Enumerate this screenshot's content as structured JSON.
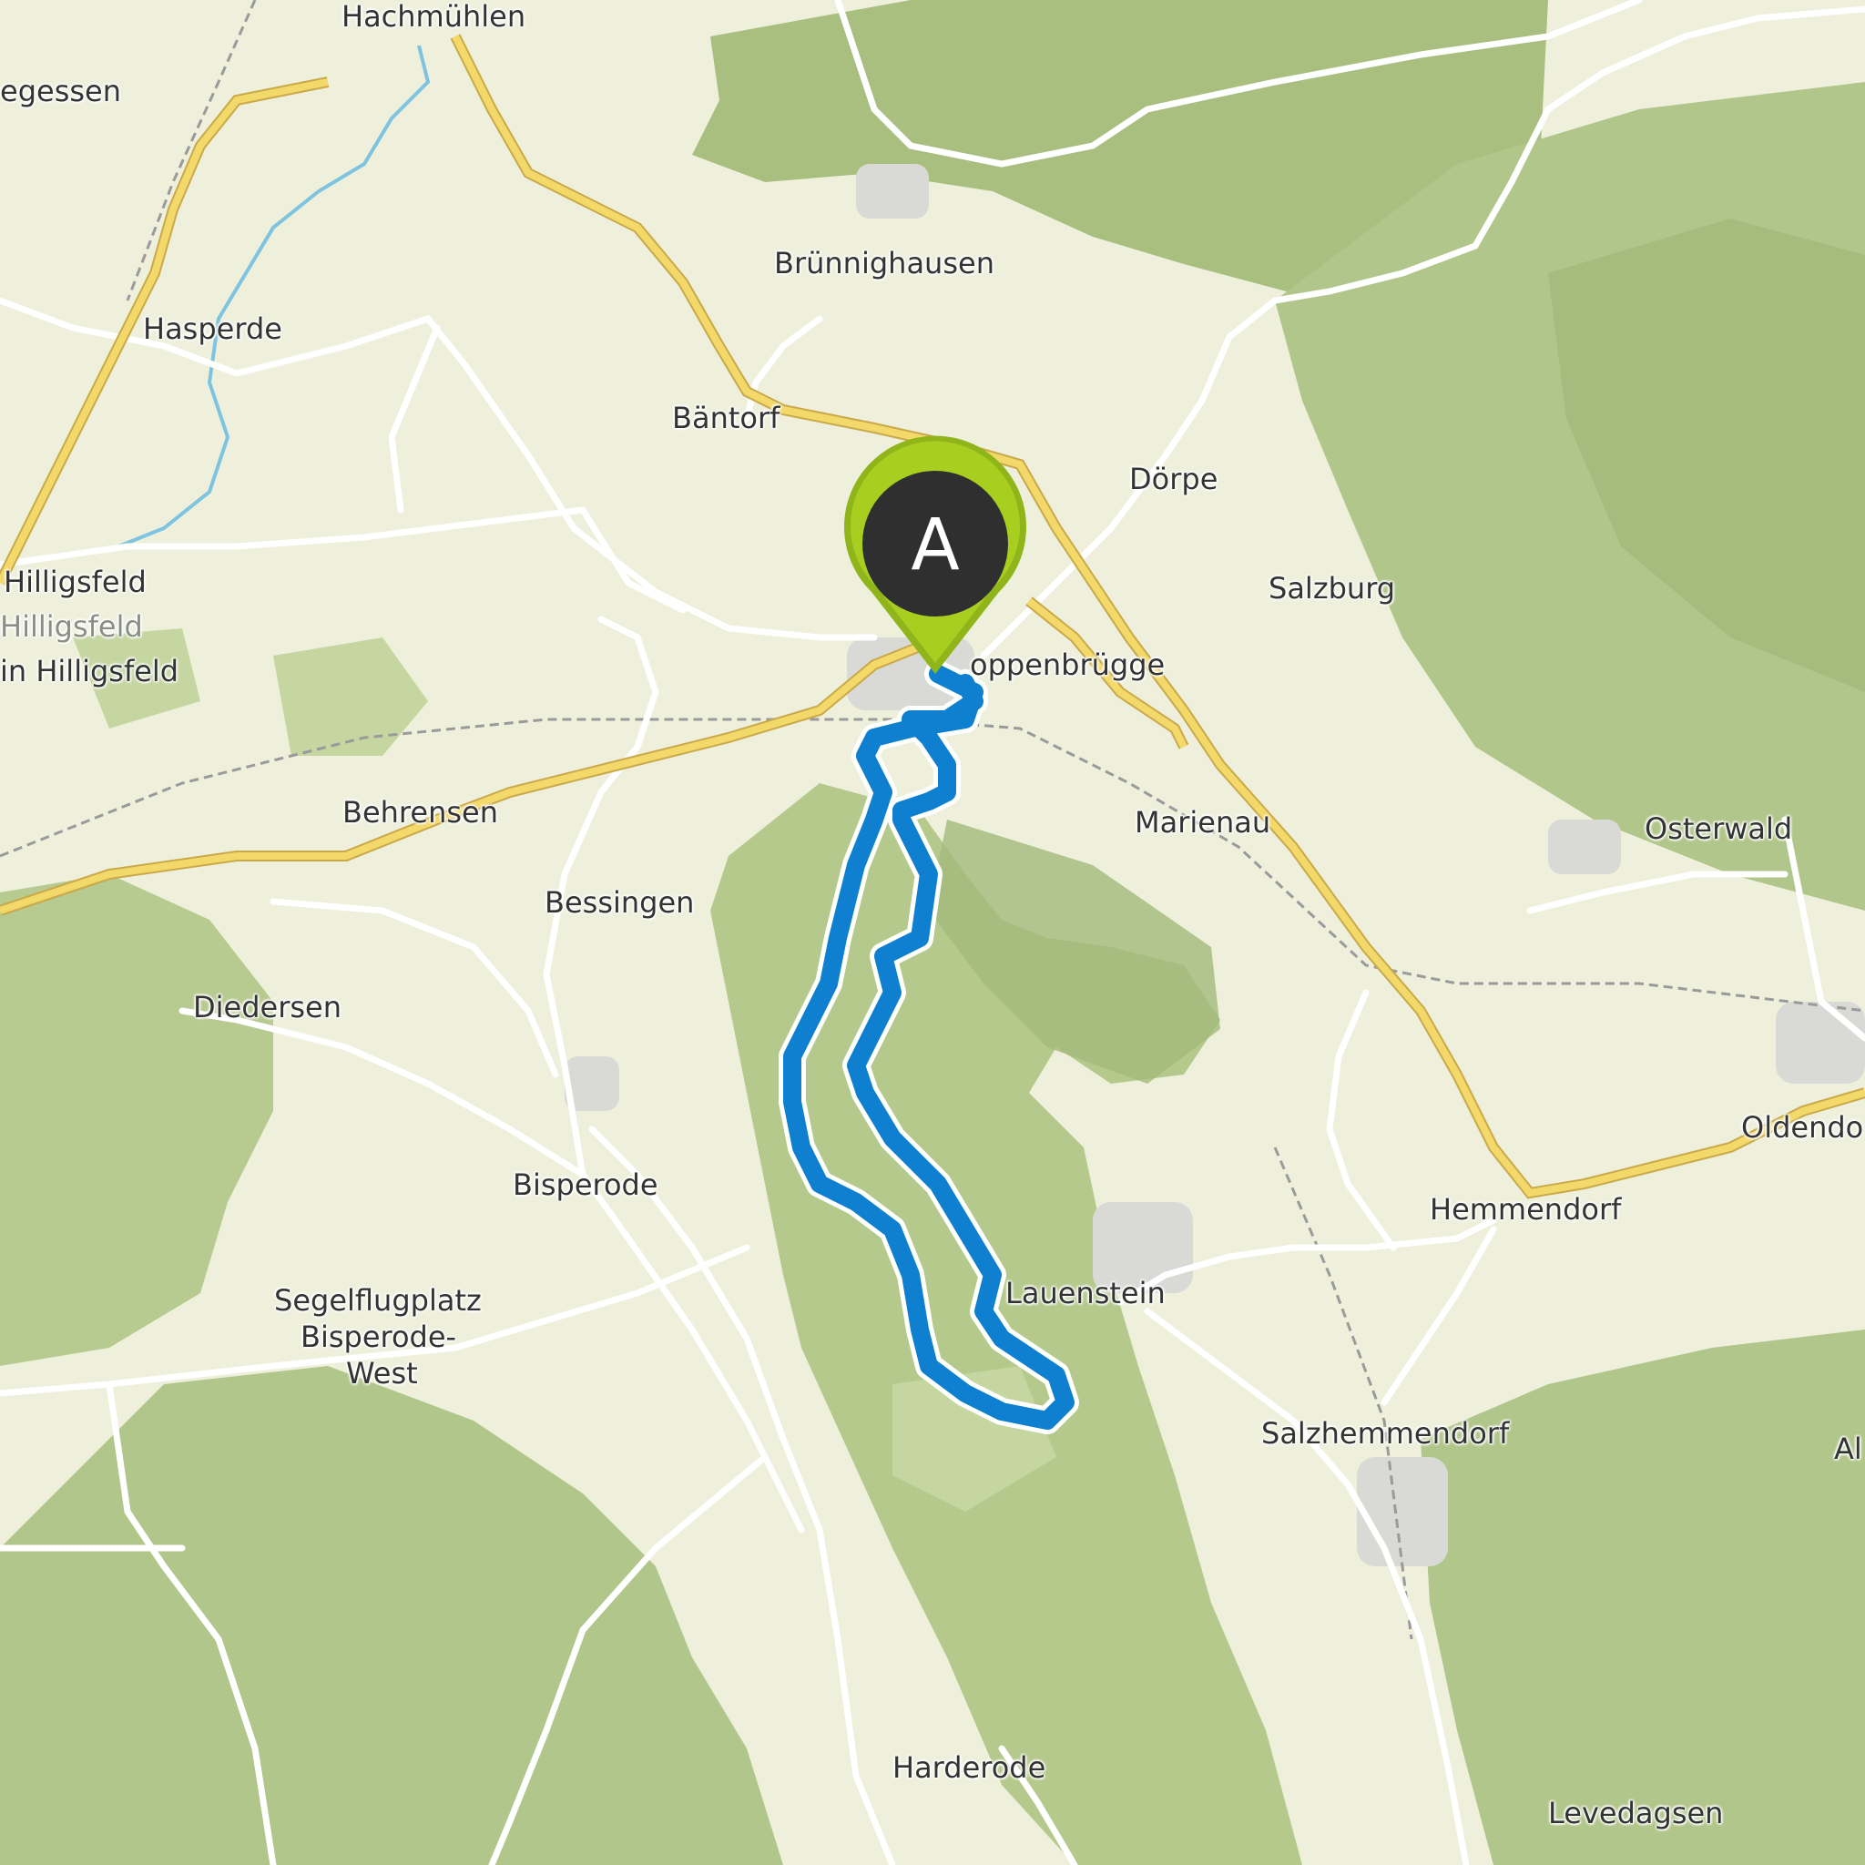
{
  "map": {
    "colors": {
      "base": "#eef0dc",
      "forest": "#b5c98c",
      "forest_dark": "#9fb676",
      "major_road": "#f3d86a",
      "minor_road": "#ffffff",
      "water": "#7ec3df",
      "route": "#0f7fd0",
      "route_casing": "#ffffff",
      "marker_fill": "#a8cf1f",
      "marker_inner": "#2f2f2f"
    },
    "marker": {
      "label": "A",
      "icon": "map-pin-icon"
    },
    "places": [
      {
        "id": "hachmuehlen",
        "name": "Hachmühlen"
      },
      {
        "id": "egessen",
        "name": "egessen"
      },
      {
        "id": "bruennighausen",
        "name": "Brünnighausen"
      },
      {
        "id": "hasperde",
        "name": "Hasperde"
      },
      {
        "id": "baentorf",
        "name": "Bäntorf"
      },
      {
        "id": "doerpe",
        "name": "Dörpe"
      },
      {
        "id": "hilligsfeld",
        "name": "Hilligsfeld"
      },
      {
        "id": "hilligsfeld-ghost",
        "name": "Hilligsfeld"
      },
      {
        "id": "in-hilligsfeld",
        "name": "in Hilligsfeld"
      },
      {
        "id": "salzburg",
        "name": "Salzburg"
      },
      {
        "id": "coppenbruegge",
        "name": "oppenbrügge"
      },
      {
        "id": "behrensen",
        "name": "Behrensen"
      },
      {
        "id": "marienau",
        "name": "Marienau"
      },
      {
        "id": "osterwald",
        "name": "Osterwald"
      },
      {
        "id": "bessingen",
        "name": "Bessingen"
      },
      {
        "id": "diedersen",
        "name": "Diedersen"
      },
      {
        "id": "oldendorf",
        "name": "Oldendo"
      },
      {
        "id": "bisperode",
        "name": "Bisperode"
      },
      {
        "id": "hemmendorf",
        "name": "Hemmendorf"
      },
      {
        "id": "lauenstein",
        "name": "Lauenstein"
      },
      {
        "id": "segelflugplatz-1",
        "name": "Segelflugplatz"
      },
      {
        "id": "segelflugplatz-2",
        "name": "Bisperode-"
      },
      {
        "id": "segelflugplatz-3",
        "name": "West"
      },
      {
        "id": "salzhemmendorf",
        "name": "Salzhemmendorf"
      },
      {
        "id": "al",
        "name": "Al"
      },
      {
        "id": "harderode",
        "name": "Harderode"
      },
      {
        "id": "levedagsen",
        "name": "Levedagsen"
      }
    ]
  }
}
